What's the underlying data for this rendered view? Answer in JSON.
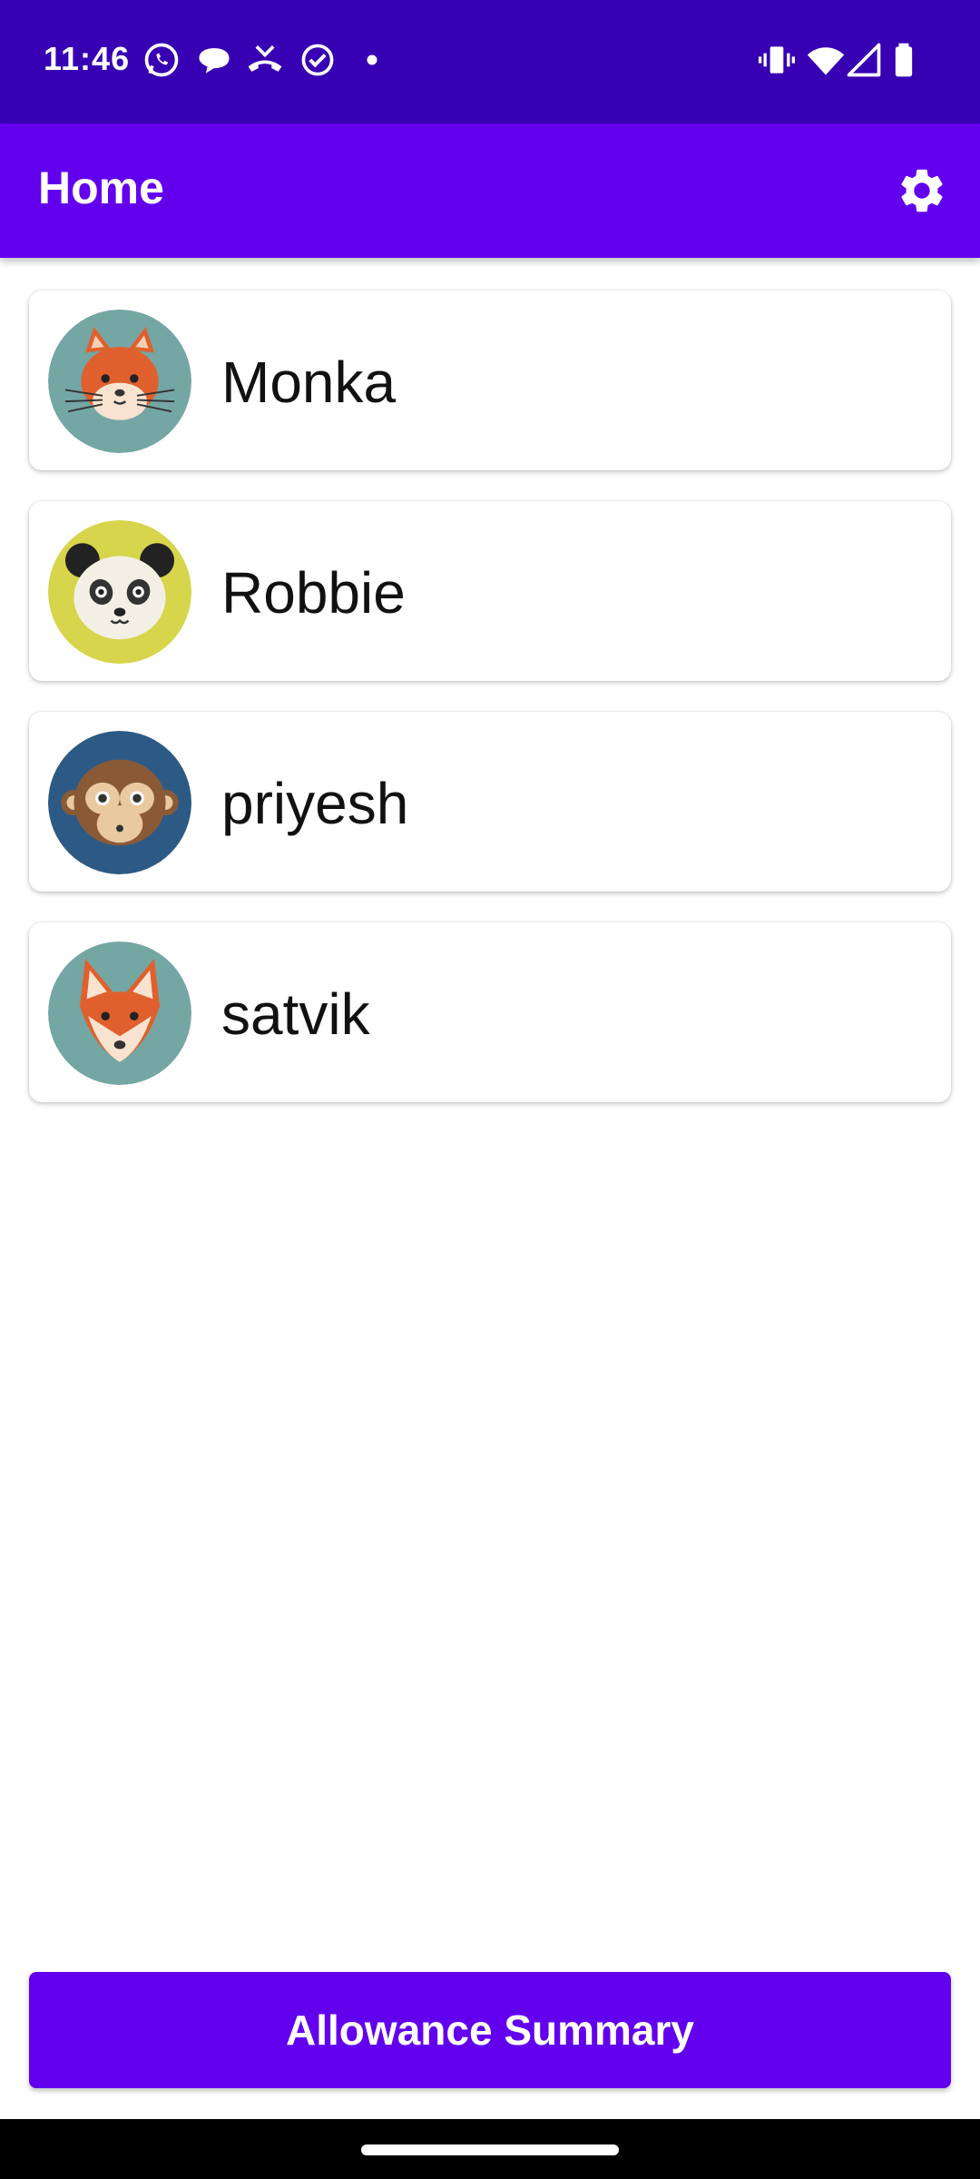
{
  "status_bar": {
    "time": "11:46",
    "left_icons": [
      "whatsapp-icon",
      "chat-bubble-icon",
      "missed-call-icon",
      "check-circle-icon",
      "dot-icon"
    ],
    "right_icons": [
      "vibrate-icon",
      "wifi-icon",
      "signal-icon",
      "battery-icon"
    ]
  },
  "app_bar": {
    "title": "Home",
    "settings_icon": "gear-icon"
  },
  "profiles": [
    {
      "name": "Monka",
      "avatar": "cat-icon",
      "bg": "#74a6a4"
    },
    {
      "name": "Robbie",
      "avatar": "panda-icon",
      "bg": "#d6d54c"
    },
    {
      "name": "priyesh",
      "avatar": "monkey-icon",
      "bg": "#2d5a84"
    },
    {
      "name": "satvik",
      "avatar": "fox-icon",
      "bg": "#74a6a4"
    }
  ],
  "footer": {
    "summary_label": "Allowance Summary"
  },
  "colors": {
    "status_bar": "#3700b3",
    "primary": "#6200ee"
  }
}
